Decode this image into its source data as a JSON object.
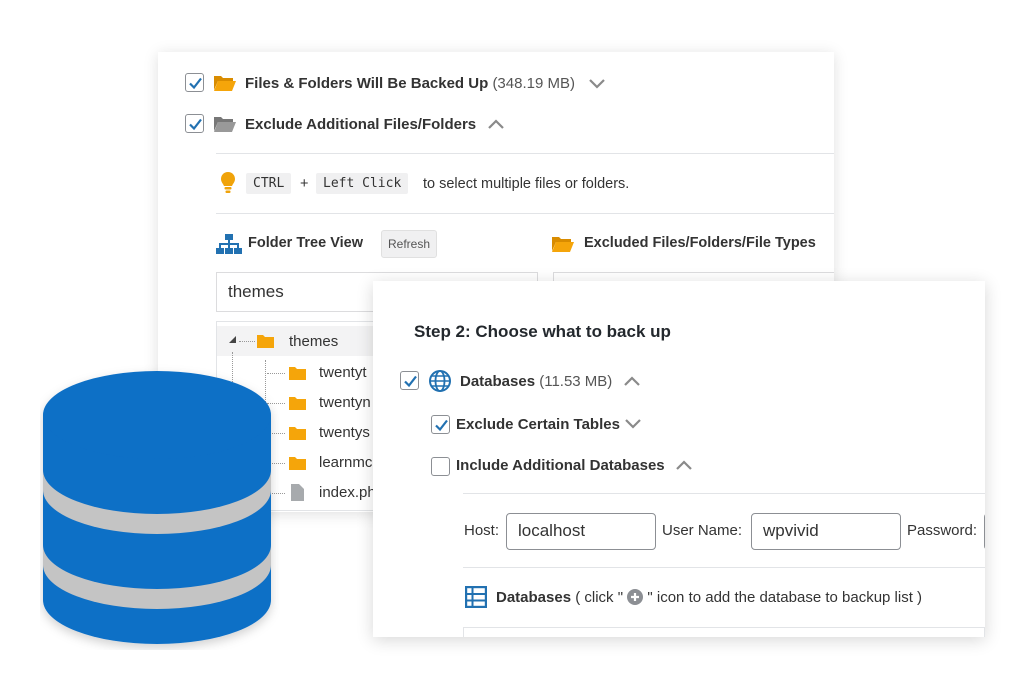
{
  "back": {
    "row1": {
      "label": "Files & Folders Will Be Backed Up",
      "size": "(348.19 MB)",
      "checked": true
    },
    "row2": {
      "label": "Exclude Additional Files/Folders",
      "checked": true
    },
    "hint": {
      "key1": "CTRL",
      "plus": "+",
      "key2": "Left Click",
      "text": "to select multiple files or folders."
    },
    "tree_title": "Folder Tree View",
    "refresh_label": "Refresh",
    "excluded_title": "Excluded Files/Folders/File Types",
    "search_value": "themes",
    "tree": {
      "root": "themes",
      "children": [
        "twentyt",
        "twentyn",
        "twentys",
        "learnmc",
        "index.ph"
      ]
    }
  },
  "front": {
    "step_title": "Step 2: Choose what to back up",
    "databases": {
      "label": "Databases",
      "size": "(11.53 MB)",
      "checked": true
    },
    "exclude_tables": {
      "label": "Exclude Certain Tables",
      "checked": true
    },
    "include_dbs": {
      "label": "Include Additional Databases",
      "checked": false
    },
    "host_label": "Host:",
    "host_value": "localhost",
    "user_label": "User Name:",
    "user_value": "wpvivid",
    "password_label": "Password:",
    "db_list": {
      "title": "Databases",
      "hint_before": "( click \"",
      "hint_after": "\" icon to add the database to backup list )"
    }
  },
  "colors": {
    "accent_blue": "#2271b1",
    "folder_orange": "#f0a30a",
    "db_blue": "#0f6fc6",
    "db_gap": "#c4c4c4"
  }
}
